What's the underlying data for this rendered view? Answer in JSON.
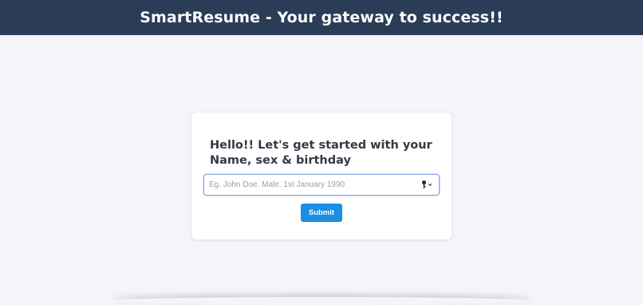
{
  "header": {
    "title": "SmartResume - Your gateway to success!!"
  },
  "form": {
    "heading": "Hello!! Let's get started with your Name, sex & birthday",
    "input_placeholder": "Eg. John Doe. Male. 1st January 1990",
    "input_value": "",
    "submit_label": "Submit"
  },
  "icons": {
    "input_addon": "key-icon"
  },
  "colors": {
    "header_bg": "#2b3d56",
    "page_bg": "#f4f5f9",
    "button_bg": "#1a8fe3",
    "input_focus_border": "#8aa8dc"
  }
}
